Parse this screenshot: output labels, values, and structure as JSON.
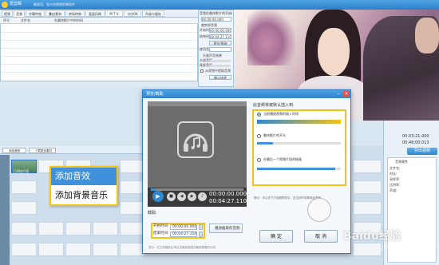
{
  "app": {
    "name": "爱剪辑",
    "title": "最易用、强大的视频剪辑软件"
  },
  "tabs": [
    "视频",
    "音频",
    "字幕特效",
    "叠加素材",
    "转场特效",
    "画面风格",
    "M T V",
    "卡拉OK",
    "升级与服务"
  ],
  "file_table": {
    "headers": [
      "序号",
      "文件名",
      "在最终影片中的时间"
    ]
  },
  "settings": {
    "labels": [
      "音频在最终影片的开始时间",
      "裁剪原音频",
      "开始时间",
      "结束时间",
      "使用音轨",
      "头尾声音效果",
      "头部音量",
      "尾部音量"
    ],
    "values": [
      "00:00:00.000",
      "00:00:00.000",
      "00:04:27.110"
    ],
    "buttons": [
      "预览/截取",
      "确认修改"
    ],
    "checkbox": "从视频中提取音频"
  },
  "player": {
    "time_current": "00:03:21.400",
    "time_total": "00:46:00.013",
    "export_button": "导出视频"
  },
  "addbar": {
    "add_audio": "添加音频",
    "add_subtitle": "下载更多素材"
  },
  "clip": {
    "label": "已添加片段"
  },
  "popup": {
    "items": [
      "添加音效",
      "添加背景音乐"
    ]
  },
  "dialog": {
    "title": "预览/截取",
    "preview": {
      "current": "00:00:00.000",
      "total": "00:04:27.110"
    },
    "cut": {
      "label": "截取:",
      "start_label": "开始时间:",
      "start": "00:00:00.000",
      "end_label": "结束时间:",
      "end": "00:04:27.110",
      "button": "播放截取的音频"
    },
    "hint": "提示：在左侧播放区域点击播放音频并截取需要的片段",
    "options": {
      "title": "此音频将被默认插入到:",
      "items": [
        "当前播放视频的插入时间",
        "最终影片的开头",
        "在最后一个视频片段的结尾"
      ]
    },
    "note": "提示：可以在下方视频预览中，定位好时间再添加音频",
    "ok": "确 定",
    "cancel": "取 消"
  },
  "properties": {
    "labels": [
      "音频属性",
      "文件名:",
      "时长:",
      "采样率:",
      "比特率:",
      "声道:"
    ]
  },
  "watermark": {
    "text": "Baidu经验",
    "sub": "jingyan.baidu.com"
  }
}
